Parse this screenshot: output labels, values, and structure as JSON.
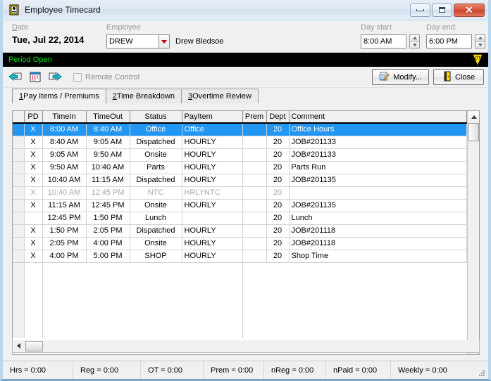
{
  "window": {
    "title": "Employee Timecard",
    "icon": "timecard-icon",
    "minimize_label": "–",
    "maximize_label": "□",
    "close_label": "✕"
  },
  "header": {
    "date_label": "Date",
    "date_value": "Tue, Jul 22, 2014",
    "employee_label": "Employee",
    "employee_code": "DREW",
    "employee_name": "Drew Bledsoe",
    "day_start_label": "Day start",
    "day_start_value": "8:00 AM",
    "day_end_label": "Day end",
    "day_end_value": "6:00 PM"
  },
  "period_strip": {
    "text": "Period Open",
    "text_color": "#00e000",
    "background": "#000000",
    "badge": "ot-badge-icon",
    "badge_label": "OT"
  },
  "toolbar": {
    "prev_icon": "previous-arrow-icon",
    "calendar_icon": "calendar-icon",
    "next_icon": "next-arrow-icon",
    "remote_control_label": "Remote Control",
    "remote_control_checked": false,
    "modify_label": "Modify...",
    "modify_icon": "modify-icon",
    "close_label": "Close",
    "close_icon": "exit-door-icon"
  },
  "tabs": [
    {
      "num": "1",
      "label": " Pay Items / Premiums",
      "active": true
    },
    {
      "num": "2",
      "label": " Time Breakdown",
      "active": false
    },
    {
      "num": "3",
      "label": " Overtime Review",
      "active": false
    }
  ],
  "grid": {
    "columns": [
      "",
      "PD",
      "TimeIn",
      "TimeOut",
      "Status",
      "PayItem",
      "Prem",
      "Dept",
      "Comment"
    ],
    "rows": [
      {
        "pd": "X",
        "timein": "8:00 AM",
        "timeout": "8:40 AM",
        "status": "Office",
        "payitem": "Office",
        "prem": "",
        "dept": "20",
        "comment": "Office Hours",
        "selected": true,
        "dim": false
      },
      {
        "pd": "X",
        "timein": "8:40 AM",
        "timeout": "9:05 AM",
        "status": "Dispatched",
        "payitem": "HOURLY",
        "prem": "",
        "dept": "20",
        "comment": "JOB#201133",
        "selected": false,
        "dim": false
      },
      {
        "pd": "X",
        "timein": "9:05 AM",
        "timeout": "9:50 AM",
        "status": "Onsite",
        "payitem": "HOURLY",
        "prem": "",
        "dept": "20",
        "comment": "JOB#201133",
        "selected": false,
        "dim": false
      },
      {
        "pd": "X",
        "timein": "9:50 AM",
        "timeout": "10:40 AM",
        "status": "Parts",
        "payitem": "HOURLY",
        "prem": "",
        "dept": "20",
        "comment": "Parts Run",
        "selected": false,
        "dim": false
      },
      {
        "pd": "X",
        "timein": "10:40 AM",
        "timeout": "11:15 AM",
        "status": "Dispatched",
        "payitem": "HOURLY",
        "prem": "",
        "dept": "20",
        "comment": "JOB#201135",
        "selected": false,
        "dim": false
      },
      {
        "pd": "X",
        "timein": "10:40 AM",
        "timeout": "12:45 PM",
        "status": "NTC",
        "payitem": "HRLYNTC",
        "prem": "",
        "dept": "20",
        "comment": "",
        "selected": false,
        "dim": true
      },
      {
        "pd": "X",
        "timein": "11:15 AM",
        "timeout": "12:45 PM",
        "status": "Onsite",
        "payitem": "HOURLY",
        "prem": "",
        "dept": "20",
        "comment": "JOB#201135",
        "selected": false,
        "dim": false
      },
      {
        "pd": "",
        "timein": "12:45 PM",
        "timeout": "1:50 PM",
        "status": "Lunch",
        "payitem": "",
        "prem": "",
        "dept": "20",
        "comment": "Lunch",
        "selected": false,
        "dim": false
      },
      {
        "pd": "X",
        "timein": "1:50 PM",
        "timeout": "2:05 PM",
        "status": "Dispatched",
        "payitem": "HOURLY",
        "prem": "",
        "dept": "20",
        "comment": "JOB#201118",
        "selected": false,
        "dim": false
      },
      {
        "pd": "X",
        "timein": "2:05 PM",
        "timeout": "4:00 PM",
        "status": "Onsite",
        "payitem": "HOURLY",
        "prem": "",
        "dept": "20",
        "comment": "JOB#201118",
        "selected": false,
        "dim": false
      },
      {
        "pd": "X",
        "timein": "4:00 PM",
        "timeout": "5:00 PM",
        "status": "SHOP",
        "payitem": "HOURLY",
        "prem": "",
        "dept": "20",
        "comment": "Shop Time",
        "selected": false,
        "dim": false
      }
    ],
    "selection_color": "#2196f3"
  },
  "statusbar": [
    "Hrs = 0:00",
    "Reg = 0:00",
    "OT = 0:00",
    "Prem = 0:00",
    "nReg = 0:00",
    "nPaid = 0:00",
    "Weekly = 0:00"
  ]
}
